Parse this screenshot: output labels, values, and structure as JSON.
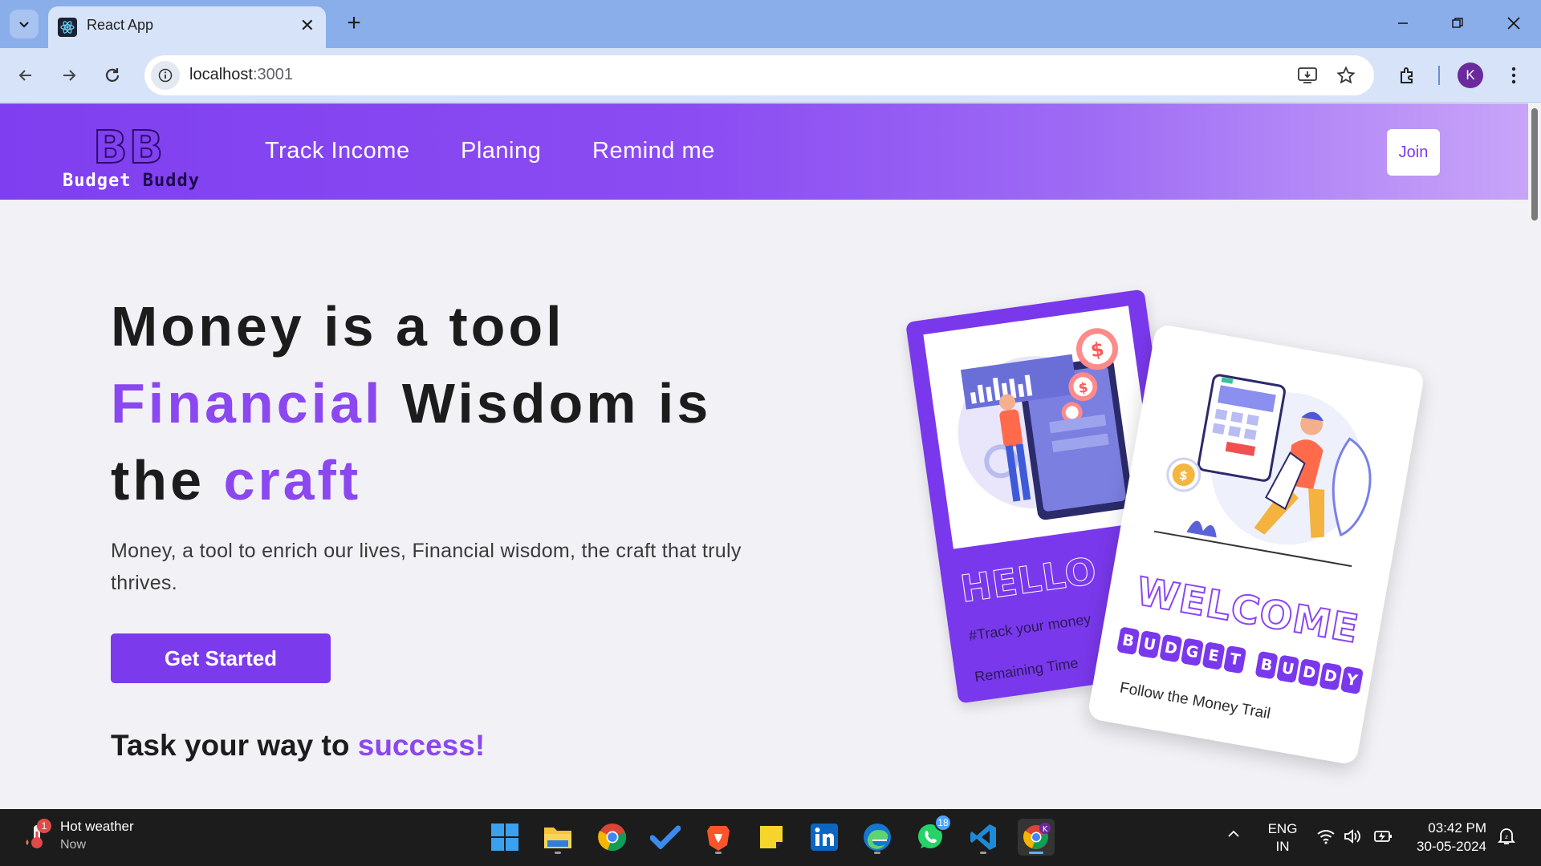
{
  "browser": {
    "tab_title": "React App",
    "url_host": "localhost",
    "url_port": ":3001",
    "profile_initial": "K"
  },
  "site": {
    "logo_mark": "BB",
    "logo_word1": "Budget",
    "logo_word2": "Buddy",
    "nav": [
      {
        "label": "Track Income"
      },
      {
        "label": "Planing"
      },
      {
        "label": "Remind me"
      }
    ],
    "join_label": "Join"
  },
  "hero": {
    "line1": "Money is a tool",
    "line2_accent": "Financial",
    "line2_rest": " Wisdom is",
    "line3_pre": "the ",
    "line3_accent": "craft",
    "subtitle": "Money, a tool to enrich our lives, Financial wisdom, the craft that truly thrives.",
    "cta_label": "Get Started",
    "tagline_pre": "Task your way to ",
    "tagline_accent": "success!"
  },
  "cards": {
    "back_title": "HELLO",
    "back_line1": "#Track your money",
    "back_line2": "Remaining Time",
    "front_title": "WELCOME",
    "front_chips": [
      "B",
      "U",
      "D",
      "G",
      "E",
      "T",
      " ",
      "B",
      "U",
      "D",
      "D",
      "Y"
    ],
    "front_caption": "Follow the Money Trail"
  },
  "taskbar": {
    "weather_title": "Hot weather",
    "weather_sub": "Now",
    "weather_badge": "1",
    "whatsapp_badge": "18",
    "lang_line1": "ENG",
    "lang_line2": "IN",
    "time": "03:42 PM",
    "date": "30-05-2024"
  },
  "colors": {
    "brand_purple": "#7c3aed",
    "accent_text": "#8b47f0"
  }
}
